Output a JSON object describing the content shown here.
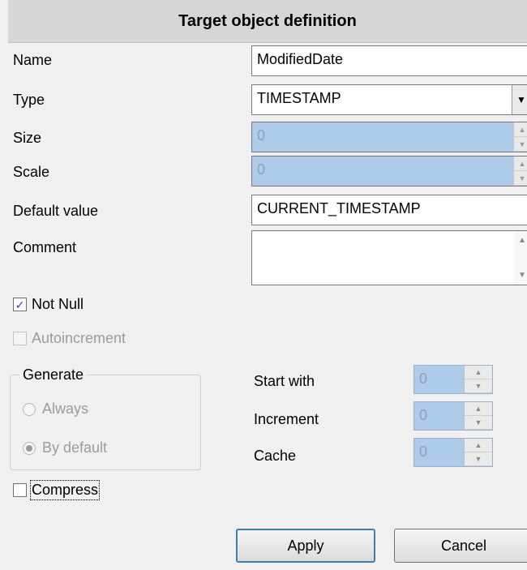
{
  "header": {
    "title": "Target object definition"
  },
  "fields": {
    "name": {
      "label": "Name",
      "value": "ModifiedDate"
    },
    "type": {
      "label": "Type",
      "value": "TIMESTAMP"
    },
    "size": {
      "label": "Size",
      "value": "0"
    },
    "scale": {
      "label": "Scale",
      "value": "0"
    },
    "default_value": {
      "label": "Default value",
      "value": "CURRENT_TIMESTAMP"
    },
    "comment": {
      "label": "Comment",
      "value": ""
    }
  },
  "checks": {
    "not_null": {
      "label": "Not Null",
      "checked": true
    },
    "autoincrement": {
      "label": "Autoincrement",
      "checked": false,
      "disabled": true
    },
    "compress": {
      "label": "Compress",
      "checked": false
    }
  },
  "generate": {
    "title": "Generate",
    "options": [
      {
        "label": "Always",
        "selected": false
      },
      {
        "label": "By default",
        "selected": true
      }
    ]
  },
  "sequence": {
    "start_with": {
      "label": "Start with",
      "value": "0"
    },
    "increment": {
      "label": "Increment",
      "value": "0"
    },
    "cache": {
      "label": "Cache",
      "value": "0"
    }
  },
  "buttons": {
    "apply": "Apply",
    "cancel": "Cancel"
  }
}
